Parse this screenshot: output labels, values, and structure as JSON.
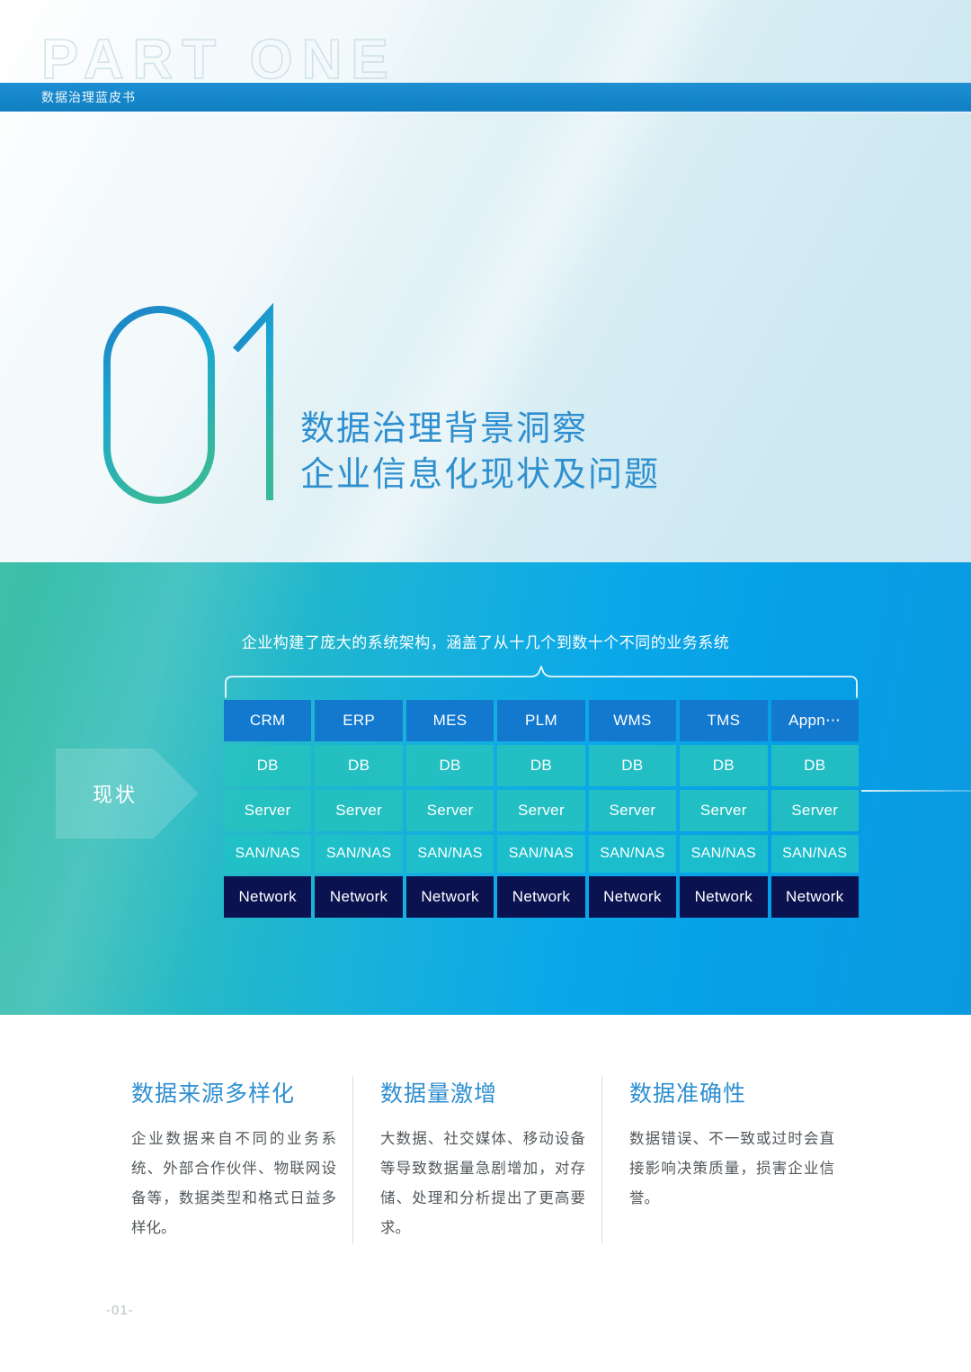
{
  "header": {
    "watermark": "PART ONE",
    "book_title": "数据治理蓝皮书"
  },
  "hero": {
    "numeral": "01",
    "title_line1": "数据治理背景洞察",
    "title_line2": "企业信息化现状及问题",
    "numeral_gradient_from": "#1f7ec4",
    "numeral_gradient_to": "#38b89b",
    "title_color": "#2e8fd0"
  },
  "diagram": {
    "caption": "企业构建了庞大的系统架构，涵盖了从十几个到数十个不同的业务系统",
    "status_label": "现状",
    "band_gradient_from": "#3fbfa6",
    "band_gradient_to": "#0b9ae0",
    "rows": [
      {
        "name": "application",
        "color": "#1379cf",
        "cells": [
          "CRM",
          "ERP",
          "MES",
          "PLM",
          "WMS",
          "TMS",
          "Appn⋯"
        ]
      },
      {
        "name": "database",
        "color": "#26c1be",
        "cells": [
          "DB",
          "DB",
          "DB",
          "DB",
          "DB",
          "DB",
          "DB"
        ]
      },
      {
        "name": "server",
        "color": "#26c1be",
        "cells": [
          "Server",
          "Server",
          "Server",
          "Server",
          "Server",
          "Server",
          "Server"
        ]
      },
      {
        "name": "storage",
        "color": "#20c2c6",
        "cells": [
          "SAN/NAS",
          "SAN/NAS",
          "SAN/NAS",
          "SAN/NAS",
          "SAN/NAS",
          "SAN/NAS",
          "SAN/NAS"
        ]
      },
      {
        "name": "network",
        "color": "#0b1250",
        "cells": [
          "Network",
          "Network",
          "Network",
          "Network",
          "Network",
          "Network",
          "Network"
        ]
      }
    ]
  },
  "points": [
    {
      "title": "数据来源多样化",
      "body": "企业数据来自不同的业务系统、外部合作伙伴、物联网设备等，数据类型和格式日益多样化。"
    },
    {
      "title": "数据量激增",
      "body": "大数据、社交媒体、移动设备等导致数据量急剧增加，对存储、处理和分析提出了更高要求。"
    },
    {
      "title": "数据准确性",
      "body": "数据错误、不一致或过时会直接影响决策质量，损害企业信誉。"
    }
  ],
  "footer": {
    "page_number": "-01-"
  }
}
